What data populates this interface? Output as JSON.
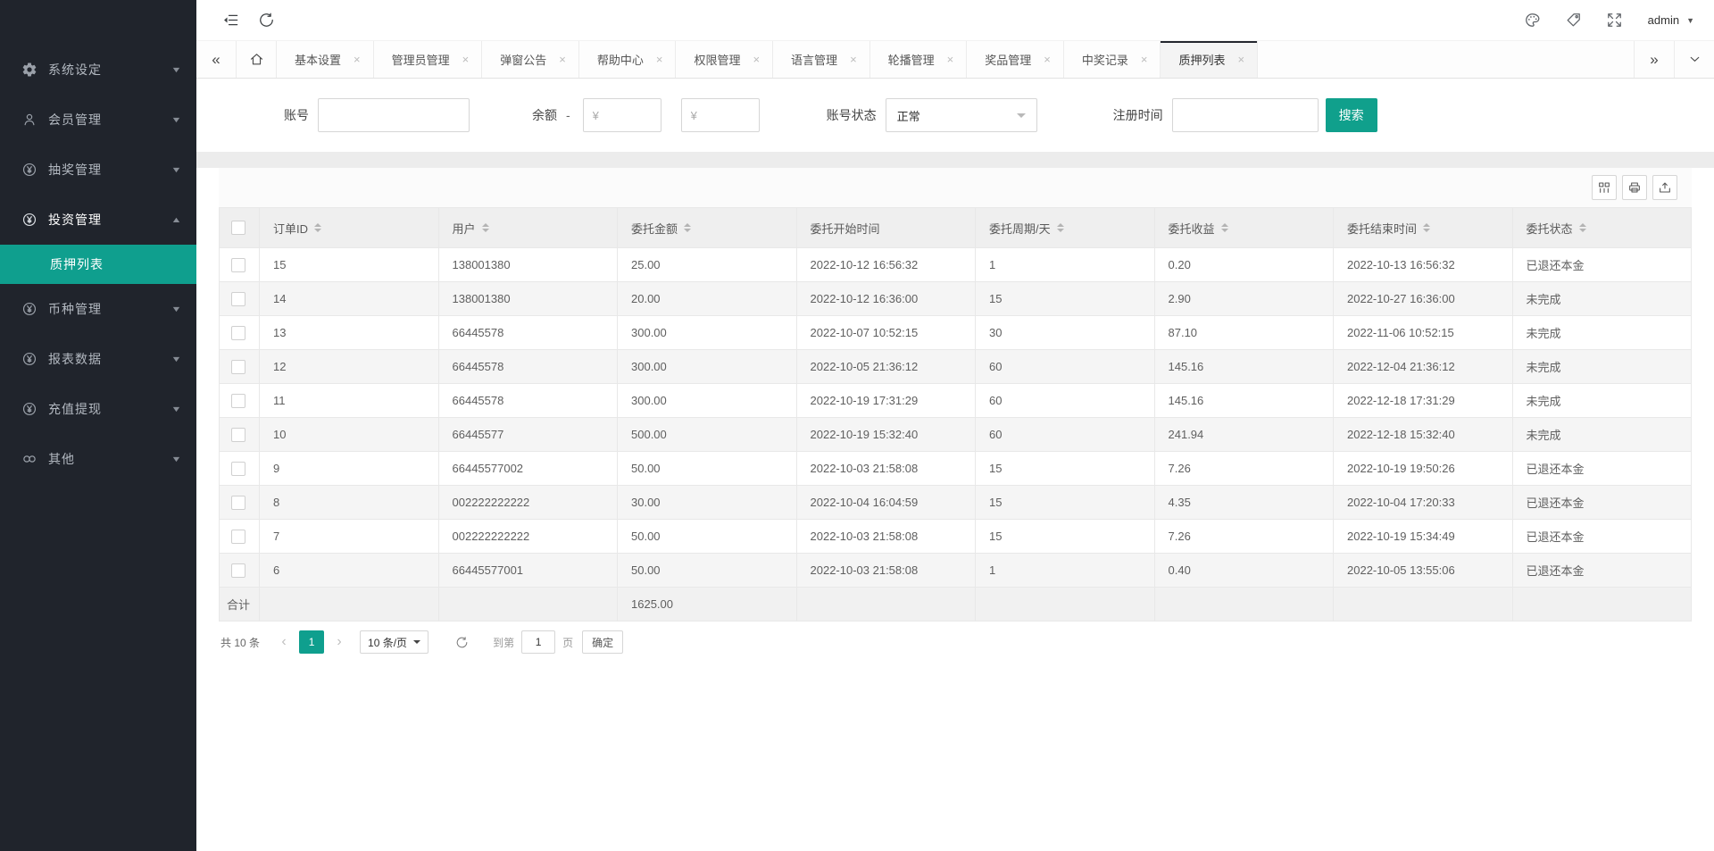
{
  "colors": {
    "accent": "#10a08c",
    "sidebar_bg": "#20242c",
    "sidebar_active_bg": "#0f9f8e"
  },
  "topbar": {
    "left_icons": [
      "collapse-icon",
      "refresh-icon"
    ],
    "right_icons": [
      "palette-icon",
      "tag-icon",
      "fullscreen-icon"
    ],
    "user": "admin"
  },
  "sidebar": {
    "items": [
      {
        "icon": "gear-icon",
        "label": "系统设定",
        "state": "collapsed"
      },
      {
        "icon": "user-icon",
        "label": "会员管理",
        "state": "collapsed"
      },
      {
        "icon": "yen-icon",
        "label": "抽奖管理",
        "state": "collapsed"
      },
      {
        "icon": "yen-icon",
        "label": "投资管理",
        "state": "expanded",
        "children": [
          {
            "label": "质押列表",
            "active": true
          }
        ]
      },
      {
        "icon": "yen-icon",
        "label": "币种管理",
        "state": "collapsed"
      },
      {
        "icon": "yen-icon",
        "label": "报表数据",
        "state": "collapsed"
      },
      {
        "icon": "yen-icon",
        "label": "充值提现",
        "state": "collapsed"
      },
      {
        "icon": "link-icon",
        "label": "其他",
        "state": "collapsed"
      }
    ]
  },
  "tabbar": {
    "left_controls": [
      "double-left-icon",
      "home-icon"
    ],
    "right_controls": [
      "double-right-icon",
      "chevron-down-icon"
    ],
    "close_glyph": "×",
    "tabs": [
      {
        "label": "基本设置"
      },
      {
        "label": "管理员管理"
      },
      {
        "label": "弹窗公告"
      },
      {
        "label": "帮助中心"
      },
      {
        "label": "权限管理"
      },
      {
        "label": "语言管理"
      },
      {
        "label": "轮播管理"
      },
      {
        "label": "奖品管理"
      },
      {
        "label": "中奖记录"
      },
      {
        "label": "质押列表",
        "active": true
      }
    ]
  },
  "filters": {
    "account_label": "账号",
    "account_value": "",
    "balance_label": "余额",
    "balance_dash": "-",
    "amount_placeholder": "¥",
    "status_label": "账号状态",
    "status_value": "正常",
    "regtime_label": "注册时间",
    "regtime_value": "",
    "search_label": "搜索"
  },
  "toolbar": {
    "icons": [
      "columns-icon",
      "print-icon",
      "export-icon"
    ]
  },
  "table": {
    "columns": [
      {
        "label": "订单ID",
        "sortable": true
      },
      {
        "label": "用户",
        "sortable": true
      },
      {
        "label": "委托金额",
        "sortable": true
      },
      {
        "label": "委托开始时间",
        "sortable": false
      },
      {
        "label": "委托周期/天",
        "sortable": true
      },
      {
        "label": "委托收益",
        "sortable": true
      },
      {
        "label": "委托结束时间",
        "sortable": true
      },
      {
        "label": "委托状态",
        "sortable": true
      }
    ],
    "rows": [
      [
        "15",
        "138001380",
        "25.00",
        "2022-10-12 16:56:32",
        "1",
        "0.20",
        "2022-10-13 16:56:32",
        "已退还本金"
      ],
      [
        "14",
        "138001380",
        "20.00",
        "2022-10-12 16:36:00",
        "15",
        "2.90",
        "2022-10-27 16:36:00",
        "未完成"
      ],
      [
        "13",
        "66445578",
        "300.00",
        "2022-10-07 10:52:15",
        "30",
        "87.10",
        "2022-11-06 10:52:15",
        "未完成"
      ],
      [
        "12",
        "66445578",
        "300.00",
        "2022-10-05 21:36:12",
        "60",
        "145.16",
        "2022-12-04 21:36:12",
        "未完成"
      ],
      [
        "11",
        "66445578",
        "300.00",
        "2022-10-19 17:31:29",
        "60",
        "145.16",
        "2022-12-18 17:31:29",
        "未完成"
      ],
      [
        "10",
        "66445577",
        "500.00",
        "2022-10-19 15:32:40",
        "60",
        "241.94",
        "2022-12-18 15:32:40",
        "未完成"
      ],
      [
        "9",
        "66445577002",
        "50.00",
        "2022-10-03 21:58:08",
        "15",
        "7.26",
        "2022-10-19 19:50:26",
        "已退还本金"
      ],
      [
        "8",
        "002222222222",
        "30.00",
        "2022-10-04 16:04:59",
        "15",
        "4.35",
        "2022-10-04 17:20:33",
        "已退还本金"
      ],
      [
        "7",
        "002222222222",
        "50.00",
        "2022-10-03 21:58:08",
        "15",
        "7.26",
        "2022-10-19 15:34:49",
        "已退还本金"
      ],
      [
        "6",
        "66445577001",
        "50.00",
        "2022-10-03 21:58:08",
        "1",
        "0.40",
        "2022-10-05 13:55:06",
        "已退还本金"
      ]
    ],
    "total": {
      "label": "合计",
      "amount": "1625.00",
      "amount_col": 2
    }
  },
  "pagination": {
    "total_text": "共 10 条",
    "prev_glyph": "‹",
    "next_glyph": "›",
    "current_page": "1",
    "page_size": "10 条/页",
    "goto_label": "到第",
    "goto_value": "1",
    "page_label": "页",
    "confirm_label": "确定"
  }
}
